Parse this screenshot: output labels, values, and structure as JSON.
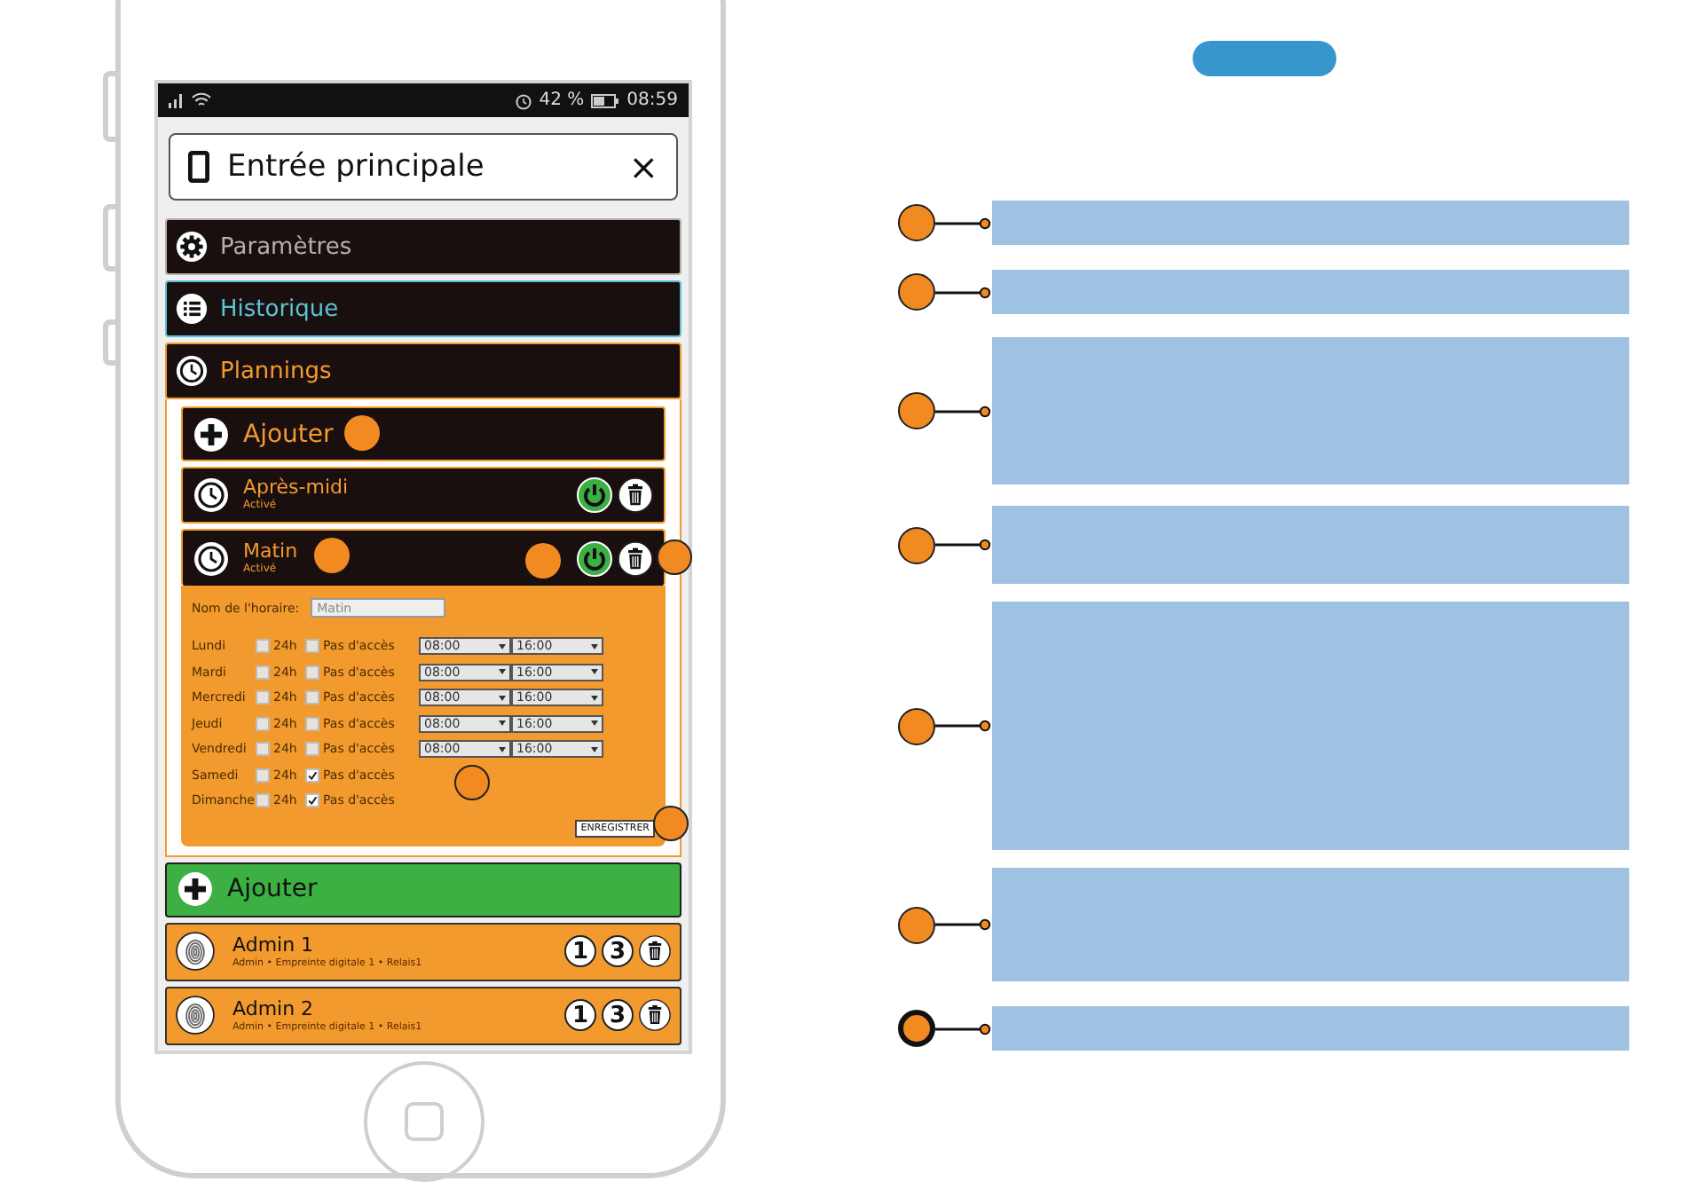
{
  "status_bar": {
    "battery": "42 %",
    "time": "08:59"
  },
  "header": {
    "title": "Entrée principale",
    "close": "×"
  },
  "menu": [
    {
      "label": "Paramètres",
      "kind": "settings",
      "color": "#b8b0a8",
      "expanded": false
    },
    {
      "label": "Historique",
      "kind": "history",
      "color": "#5cc3d6",
      "expanded": false
    },
    {
      "label": "Plannings",
      "kind": "schedules",
      "color": "#f39a2e",
      "expanded": true
    }
  ],
  "plannings": {
    "add_label": "Ajouter",
    "schedules": [
      {
        "name": "Après-midi",
        "status": "Activé",
        "enabled": true,
        "expanded": false
      },
      {
        "name": "Matin",
        "status": "Activé",
        "enabled": true,
        "expanded": true
      }
    ]
  },
  "schedule_form": {
    "name_label": "Nom de l'horaire:",
    "name_value": "Matin",
    "save": "ENREGISTRER",
    "days": [
      {
        "day": "Lundi",
        "all_day_label": "24h",
        "all_day": false,
        "no_access_label": "Pas d'accès",
        "no_access": false,
        "start": "08:00",
        "end": "16:00"
      },
      {
        "day": "Mardi",
        "all_day_label": "24h",
        "all_day": false,
        "no_access_label": "Pas d'accès",
        "no_access": false,
        "start": "08:00",
        "end": "16:00"
      },
      {
        "day": "Mercredi",
        "all_day_label": "24h",
        "all_day": false,
        "no_access_label": "Pas d'accès",
        "no_access": false,
        "start": "08:00",
        "end": "16:00"
      },
      {
        "day": "Jeudi",
        "all_day_label": "24h",
        "all_day": false,
        "no_access_label": "Pas d'accès",
        "no_access": false,
        "start": "08:00",
        "end": "16:00"
      },
      {
        "day": "Vendredi",
        "all_day_label": "24h",
        "all_day": false,
        "no_access_label": "Pas d'accès",
        "no_access": false,
        "start": "08:00",
        "end": "16:00"
      },
      {
        "day": "Samedi",
        "all_day_label": "24h",
        "all_day": false,
        "no_access_label": "Pas d'accès",
        "no_access": true
      },
      {
        "day": "Dimanche",
        "all_day_label": "24h",
        "all_day": false,
        "no_access_label": "Pas d'accès",
        "no_access": true
      }
    ]
  },
  "add_user": "Ajouter",
  "users": [
    {
      "name": "Admin 1",
      "details": "Admin • Empreinte digitale 1 • Relais1",
      "badges": [
        "1",
        "3"
      ]
    },
    {
      "name": "Admin 2",
      "details": "Admin • Empreinte digitale 1 • Relais1",
      "badges": [
        "1",
        "3"
      ]
    }
  ],
  "callouts": [
    {
      "highlighted": false
    },
    {
      "highlighted": false
    },
    {
      "highlighted": false
    },
    {
      "highlighted": false
    },
    {
      "highlighted": false
    },
    {
      "highlighted": false
    },
    {
      "highlighted": true
    }
  ]
}
